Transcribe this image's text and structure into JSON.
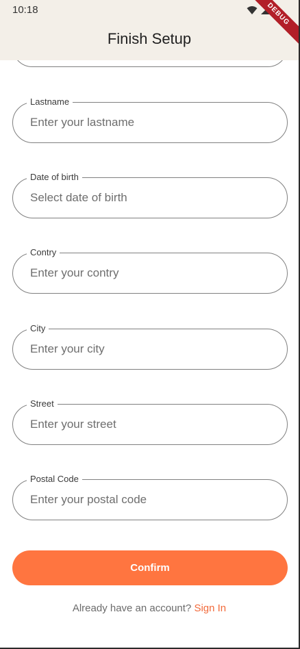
{
  "status_bar": {
    "time": "10:18"
  },
  "debug_banner": "DEBUG",
  "app_bar": {
    "title": "Finish Setup"
  },
  "form": {
    "fields": [
      {
        "label": "Lastname",
        "placeholder": "Enter your lastname",
        "value": ""
      },
      {
        "label": "Date of birth",
        "placeholder": "Select date of birth",
        "value": ""
      },
      {
        "label": "Contry",
        "placeholder": "Enter your contry",
        "value": ""
      },
      {
        "label": "City",
        "placeholder": "Enter your city",
        "value": ""
      },
      {
        "label": "Street",
        "placeholder": "Enter your street",
        "value": ""
      },
      {
        "label": "Postal Code",
        "placeholder": "Enter your postal code",
        "value": ""
      }
    ],
    "confirm_label": "Confirm"
  },
  "footer": {
    "prompt": "Already have an account?",
    "link_label": "Sign In"
  },
  "colors": {
    "accent": "#ff7540",
    "link": "#f26a3a",
    "app_bar_bg": "#f3efe8",
    "field_border": "#7f7f7f"
  },
  "icons": [
    "wifi-icon",
    "cellular-signal-icon",
    "battery-icon"
  ]
}
